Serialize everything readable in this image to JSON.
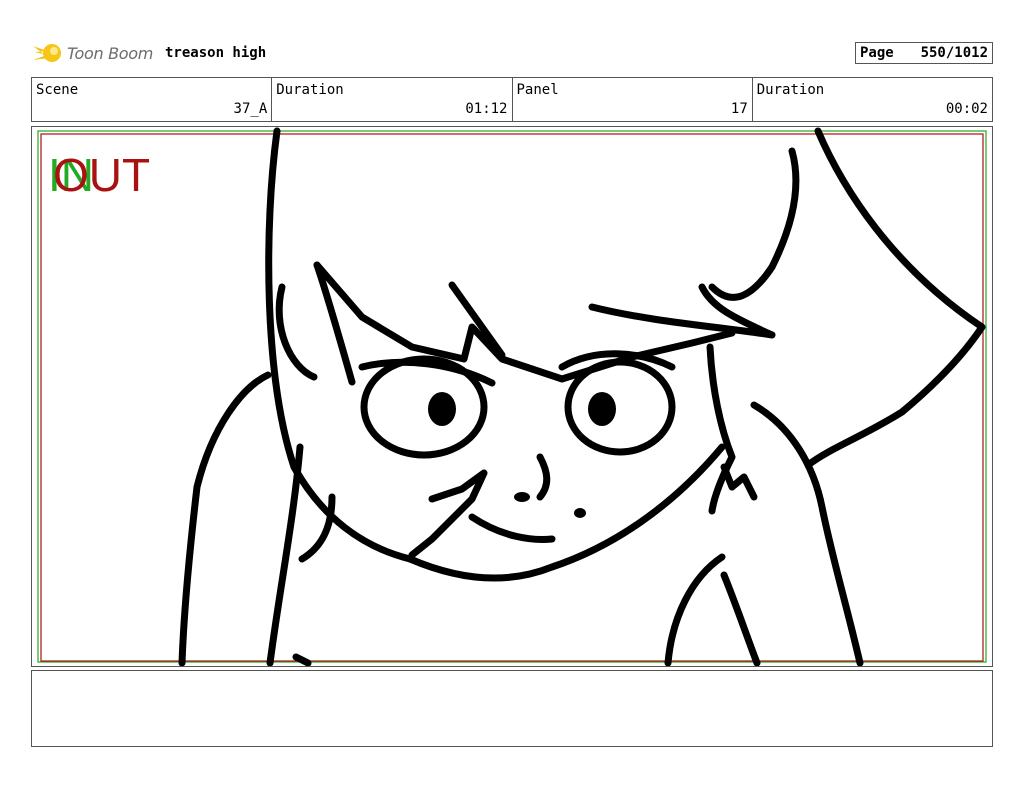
{
  "header": {
    "brand": "Toon Boom",
    "project_title": "treason high",
    "page_label": "Page",
    "page_value": "550/1012"
  },
  "info": [
    {
      "label": "Scene",
      "value": "37_A"
    },
    {
      "label": "Duration",
      "value": "01:12"
    },
    {
      "label": "Panel",
      "value": "17"
    },
    {
      "label": "Duration",
      "value": "00:02"
    }
  ],
  "panel": {
    "in_marker": "IN",
    "out_marker": "OUT",
    "colors": {
      "in": "#22aa22",
      "out": "#aa1111",
      "safe_frame": "#aa1111",
      "title_frame": "#22aa22"
    }
  },
  "notes": {
    "text": ""
  }
}
